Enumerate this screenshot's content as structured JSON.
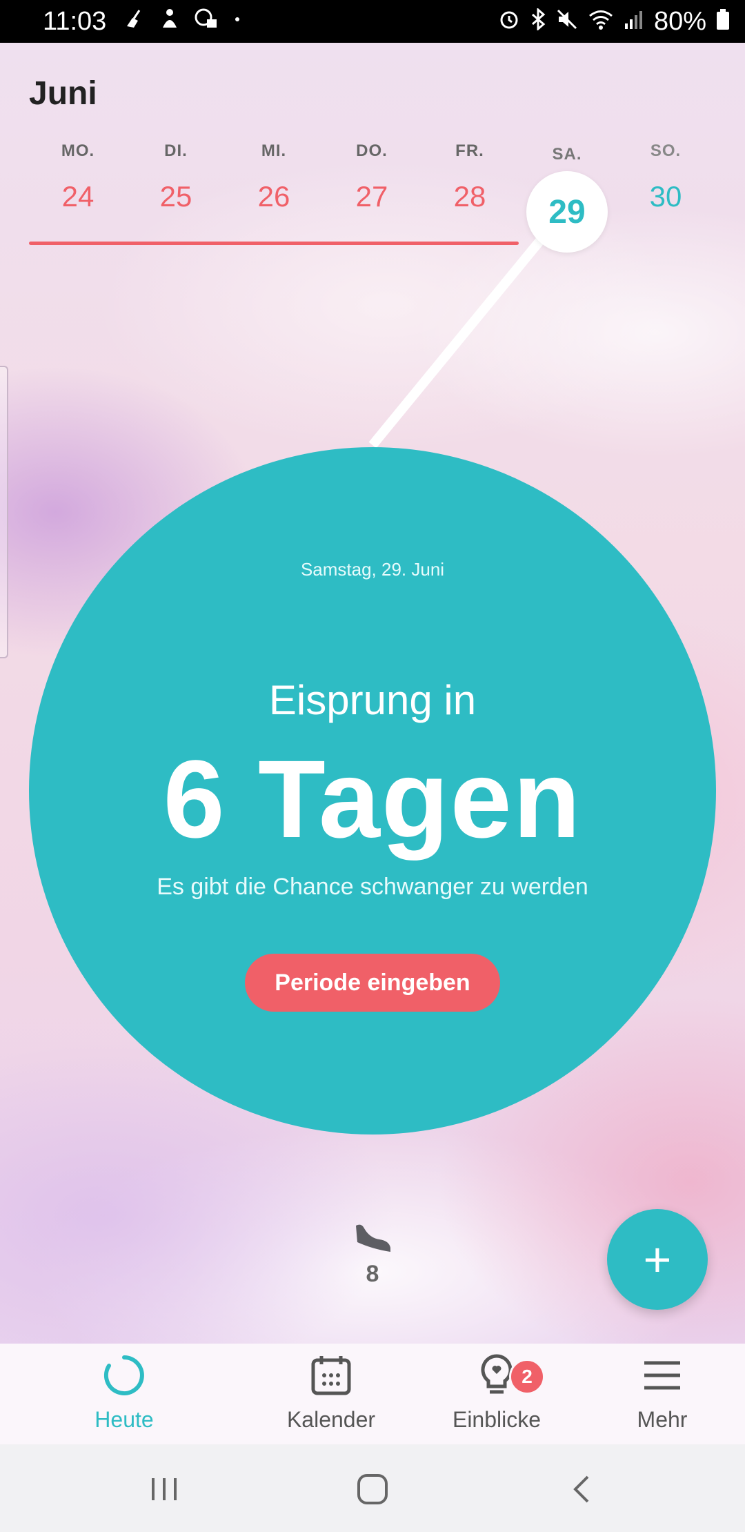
{
  "status_bar": {
    "time": "11:03",
    "battery": "80%",
    "left_icons": [
      "broom-icon",
      "figure-icon",
      "lock-chat-icon",
      "dot-icon"
    ],
    "right_icons": [
      "alarm-icon",
      "bluetooth-icon",
      "mute-icon",
      "wifi-icon",
      "signal-icon",
      "battery-icon"
    ]
  },
  "calendar": {
    "month": "Juni",
    "days": [
      {
        "name": "MO.",
        "num": "24"
      },
      {
        "name": "DI.",
        "num": "25"
      },
      {
        "name": "MI.",
        "num": "26"
      },
      {
        "name": "DO.",
        "num": "27"
      },
      {
        "name": "FR.",
        "num": "28"
      },
      {
        "name": "SA.",
        "num": "29"
      },
      {
        "name": "SO.",
        "num": "30"
      }
    ],
    "selected_day": "29"
  },
  "circle": {
    "date": "Samstag, 29. Juni",
    "lead": "Eisprung in",
    "big": "6 Tagen",
    "sub": "Es gibt die Chance schwanger zu werden",
    "button_label": "Periode eingeben"
  },
  "steps": {
    "icon": "shoe-icon",
    "count": "8"
  },
  "fab": {
    "label": "+"
  },
  "bottom_nav": [
    {
      "label": "Heute",
      "icon": "today-ring-icon",
      "active": true
    },
    {
      "label": "Kalender",
      "icon": "calendar-icon",
      "active": false
    },
    {
      "label": "Einblicke",
      "icon": "insights-bulb-icon",
      "active": false,
      "badge": "2"
    },
    {
      "label": "Mehr",
      "icon": "menu-icon",
      "active": false
    }
  ],
  "colors": {
    "accent": "#2ebcc4",
    "period": "#f06068"
  }
}
